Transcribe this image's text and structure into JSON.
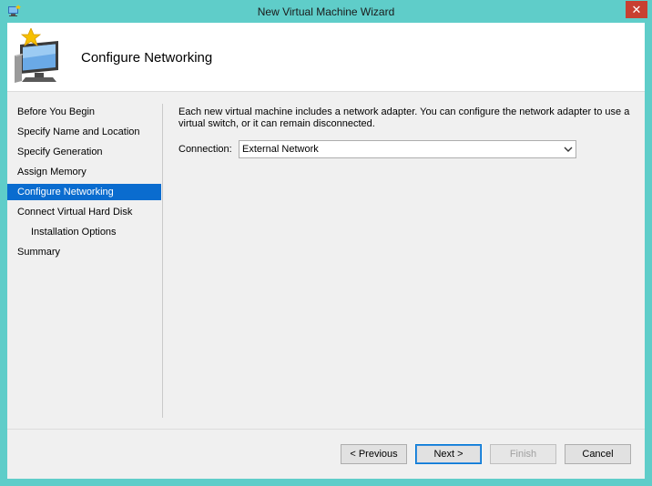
{
  "window": {
    "title": "New Virtual Machine Wizard",
    "close_symbol": "✕",
    "accent_color": "#5fcdc9",
    "close_color": "#c84031"
  },
  "header": {
    "page_title": "Configure Networking",
    "icon": "vm-wizard-icon"
  },
  "nav": {
    "items": [
      {
        "label": "Before You Begin"
      },
      {
        "label": "Specify Name and Location"
      },
      {
        "label": "Specify Generation"
      },
      {
        "label": "Assign Memory"
      },
      {
        "label": "Configure Networking",
        "selected": true
      },
      {
        "label": "Connect Virtual Hard Disk"
      },
      {
        "label": "Installation Options",
        "sub": true
      },
      {
        "label": "Summary"
      }
    ],
    "selected_color": "#0a6ccf"
  },
  "content": {
    "description": "Each new virtual machine includes a network adapter. You can configure the network adapter to use a virtual switch, or it can remain disconnected.",
    "connection_label": "Connection:",
    "connection_value": "External Network"
  },
  "buttons": {
    "previous": "< Previous",
    "next": "Next >",
    "finish": "Finish",
    "cancel": "Cancel"
  }
}
